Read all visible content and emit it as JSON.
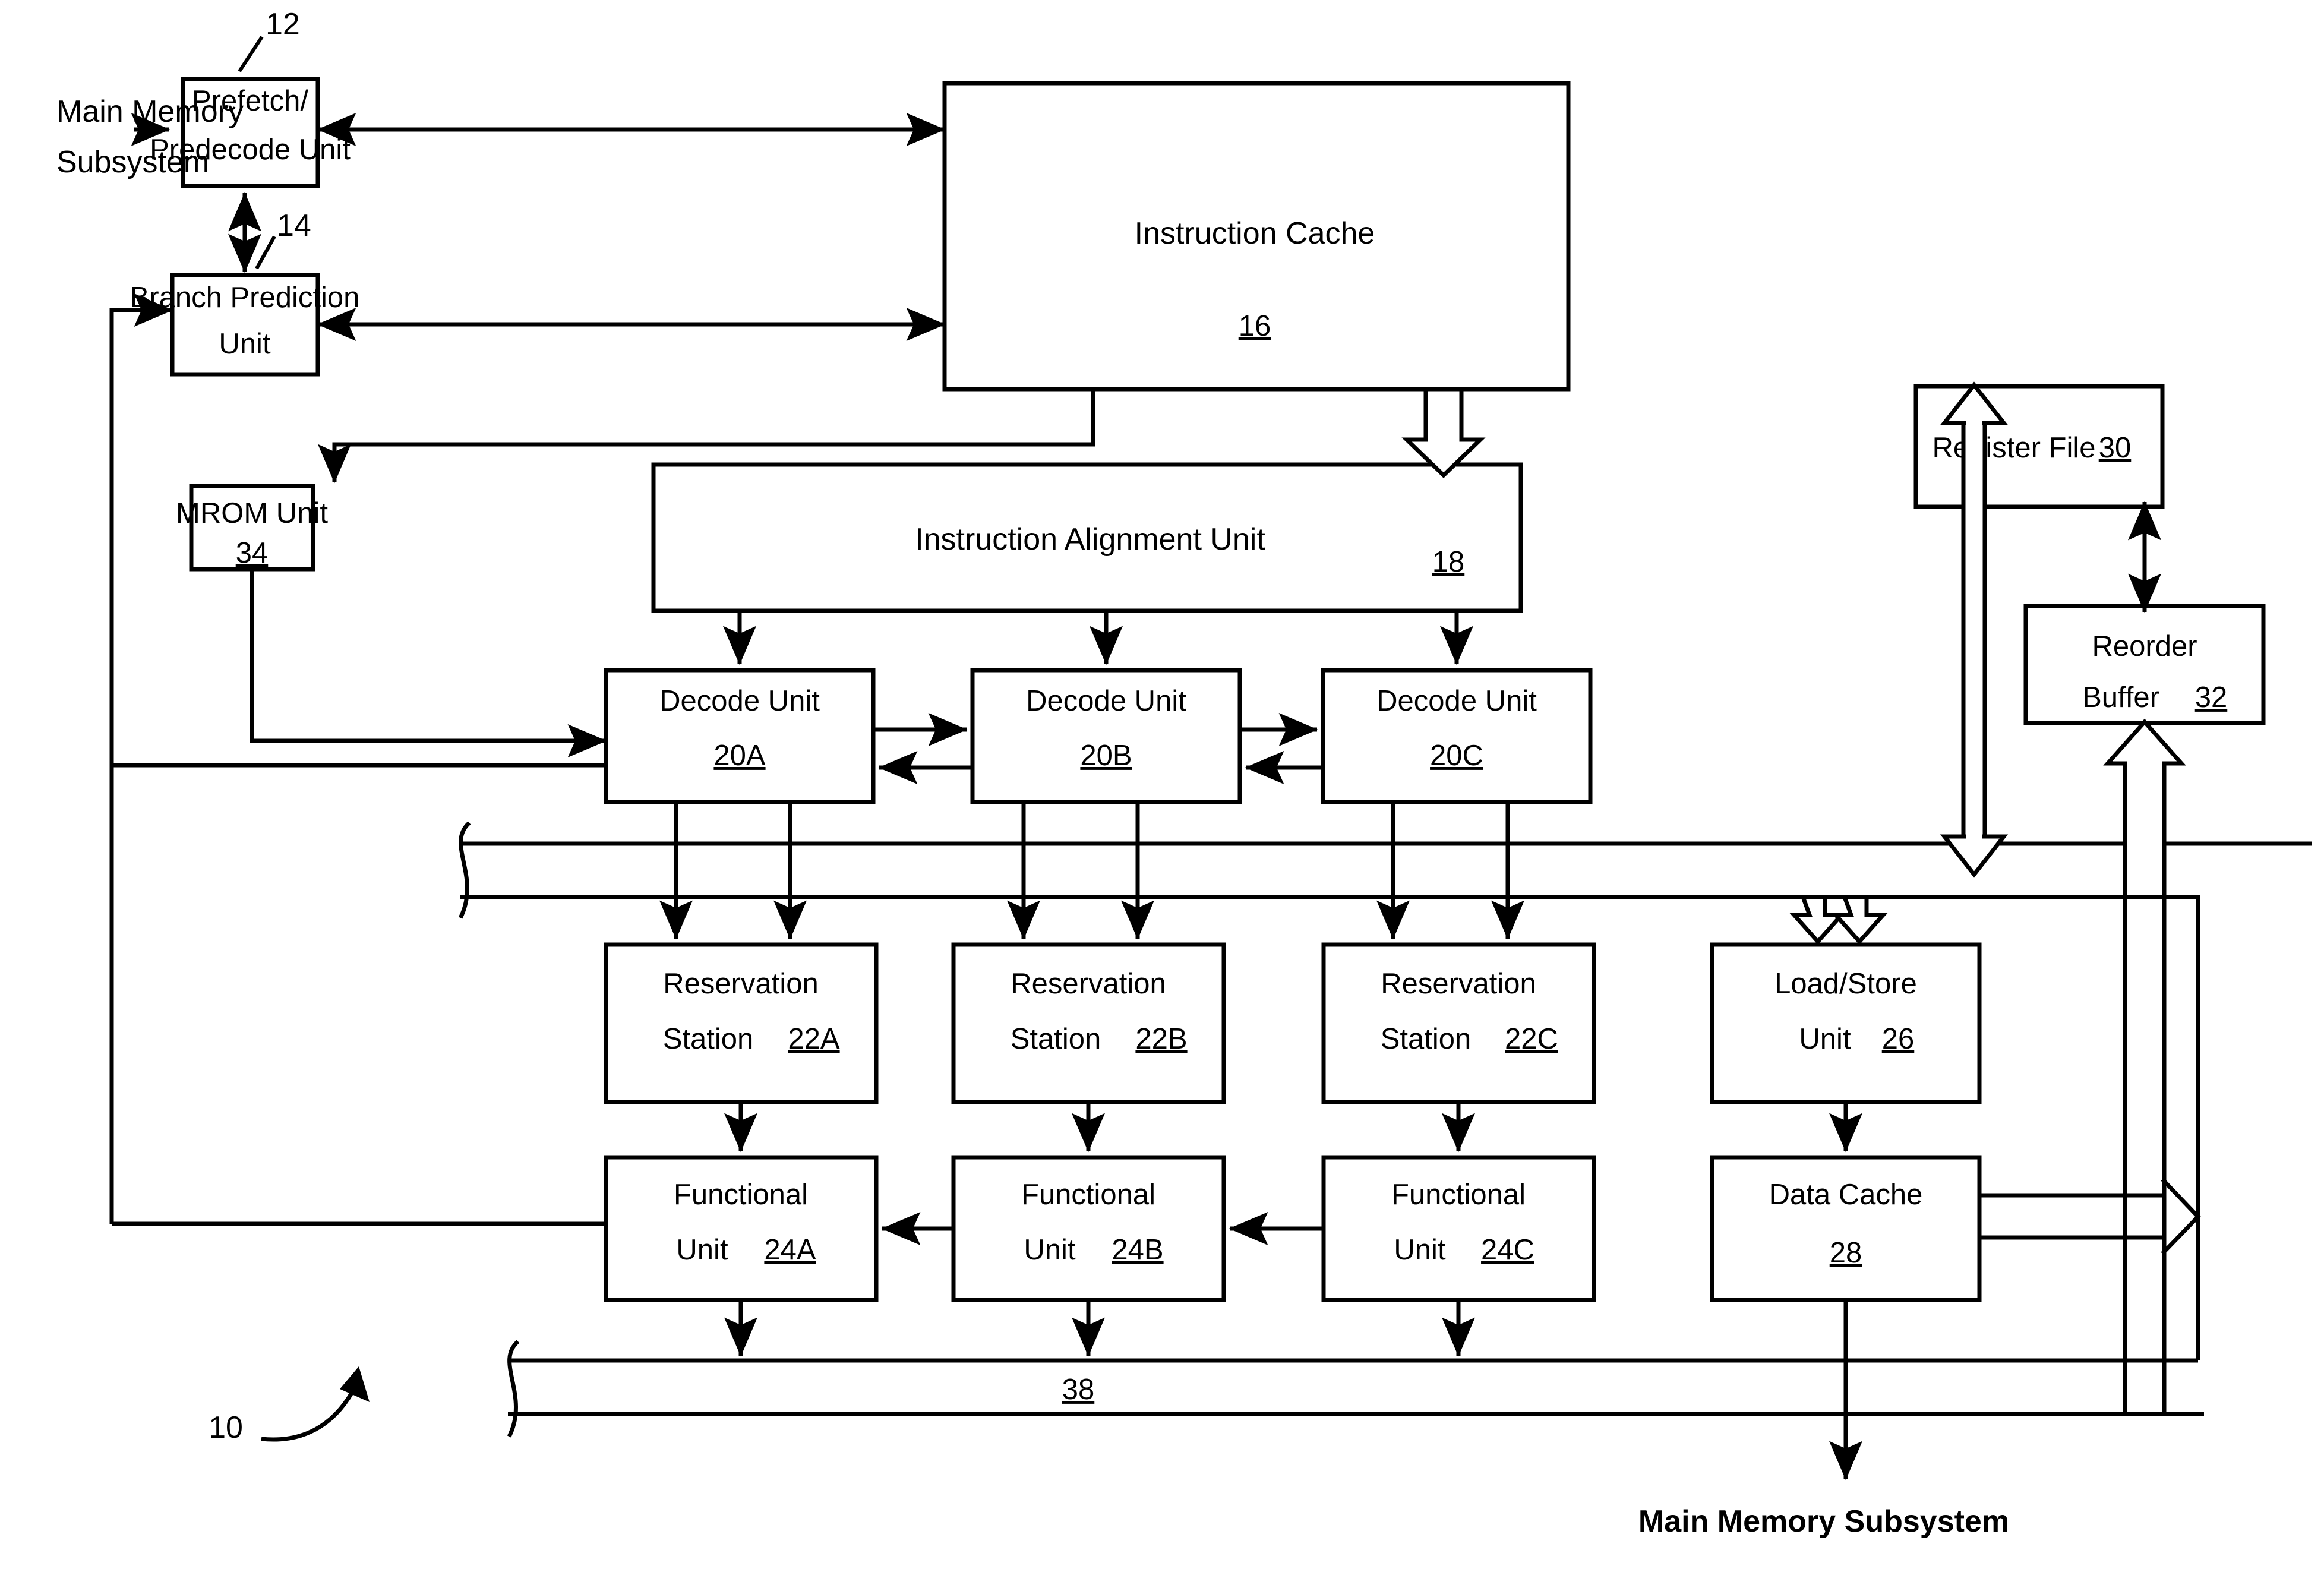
{
  "figure": {
    "ref_label": "10",
    "bus_label": "38"
  },
  "external_labels": {
    "top_left_memory": "Main Memory\nSubsystem",
    "top_left_memory_line1": "Main Memory",
    "top_left_memory_line2": "Subsystem",
    "bottom_memory": "Main Memory Subsystem"
  },
  "blocks": [
    {
      "id": "prefetch",
      "line1": "Prefetch/",
      "line2": "Predecode Unit",
      "ref": "12",
      "ref_position": "callout"
    },
    {
      "id": "branch",
      "line1": "Branch Prediction",
      "line2": "Unit",
      "ref": "14",
      "ref_position": "callout"
    },
    {
      "id": "icache",
      "line1": "Instruction Cache",
      "line2": "",
      "ref": "16",
      "ref_position": "inside"
    },
    {
      "id": "mrom",
      "line1": "MROM Unit",
      "line2": "",
      "ref": "34",
      "ref_position": "inside"
    },
    {
      "id": "ialign",
      "line1": "Instruction Alignment Unit",
      "line2": "",
      "ref": "18",
      "ref_position": "inline-right"
    },
    {
      "id": "decode_a",
      "line1": "Decode Unit",
      "line2": "",
      "ref": "20A",
      "ref_position": "inside"
    },
    {
      "id": "decode_b",
      "line1": "Decode Unit",
      "line2": "",
      "ref": "20B",
      "ref_position": "inside"
    },
    {
      "id": "decode_c",
      "line1": "Decode Unit",
      "line2": "",
      "ref": "20C",
      "ref_position": "inside"
    },
    {
      "id": "rs_a",
      "line1": "Reservation",
      "line2": "Station",
      "ref": "22A",
      "ref_position": "inline"
    },
    {
      "id": "rs_b",
      "line1": "Reservation",
      "line2": "Station",
      "ref": "22B",
      "ref_position": "inline"
    },
    {
      "id": "rs_c",
      "line1": "Reservation",
      "line2": "Station",
      "ref": "22C",
      "ref_position": "inline"
    },
    {
      "id": "fu_a",
      "line1": "Functional",
      "line2": "Unit",
      "ref": "24A",
      "ref_position": "inline"
    },
    {
      "id": "fu_b",
      "line1": "Functional",
      "line2": "Unit",
      "ref": "24B",
      "ref_position": "inline"
    },
    {
      "id": "fu_c",
      "line1": "Functional",
      "line2": "Unit",
      "ref": "24C",
      "ref_position": "inline"
    },
    {
      "id": "lsu",
      "line1": "Load/Store",
      "line2": "Unit",
      "ref": "26",
      "ref_position": "inline"
    },
    {
      "id": "dcache",
      "line1": "Data Cache",
      "line2": "",
      "ref": "28",
      "ref_position": "inside"
    },
    {
      "id": "regfile",
      "line1": "Register File",
      "line2": "",
      "ref": "30",
      "ref_position": "inline"
    },
    {
      "id": "rob",
      "line1": "Reorder",
      "line2": "Buffer",
      "ref": "32",
      "ref_position": "inline"
    }
  ],
  "text": {
    "prefetch_l1": "Prefetch/",
    "prefetch_l2": "Predecode Unit",
    "prefetch_ref": "12",
    "branch_l1": "Branch Prediction",
    "branch_l2": "Unit",
    "branch_ref": "14",
    "icache_title": "Instruction Cache",
    "icache_ref": "16",
    "mrom_title": "MROM Unit",
    "mrom_ref": "34",
    "ialign_title": "Instruction Alignment Unit",
    "ialign_ref": "18",
    "decode_title": "Decode Unit",
    "decode_a_ref": "20A",
    "decode_b_ref": "20B",
    "decode_c_ref": "20C",
    "rs_l1": "Reservation",
    "rs_l2": "Station",
    "rs_a_ref": "22A",
    "rs_b_ref": "22B",
    "rs_c_ref": "22C",
    "fu_l1": "Functional",
    "fu_l2": "Unit",
    "fu_a_ref": "24A",
    "fu_b_ref": "24B",
    "fu_c_ref": "24C",
    "lsu_l1": "Load/Store",
    "lsu_l2": "Unit",
    "lsu_ref": "26",
    "dcache_title": "Data Cache",
    "dcache_ref": "28",
    "regfile_title": "Register File",
    "regfile_ref": "30",
    "rob_l1": "Reorder",
    "rob_l2": "Buffer",
    "rob_ref": "32",
    "mm_top_l1": "Main Memory",
    "mm_top_l2": "Subsystem",
    "mm_bottom": "Main Memory Subsystem",
    "fig_ref": "10",
    "bus_ref": "38"
  }
}
